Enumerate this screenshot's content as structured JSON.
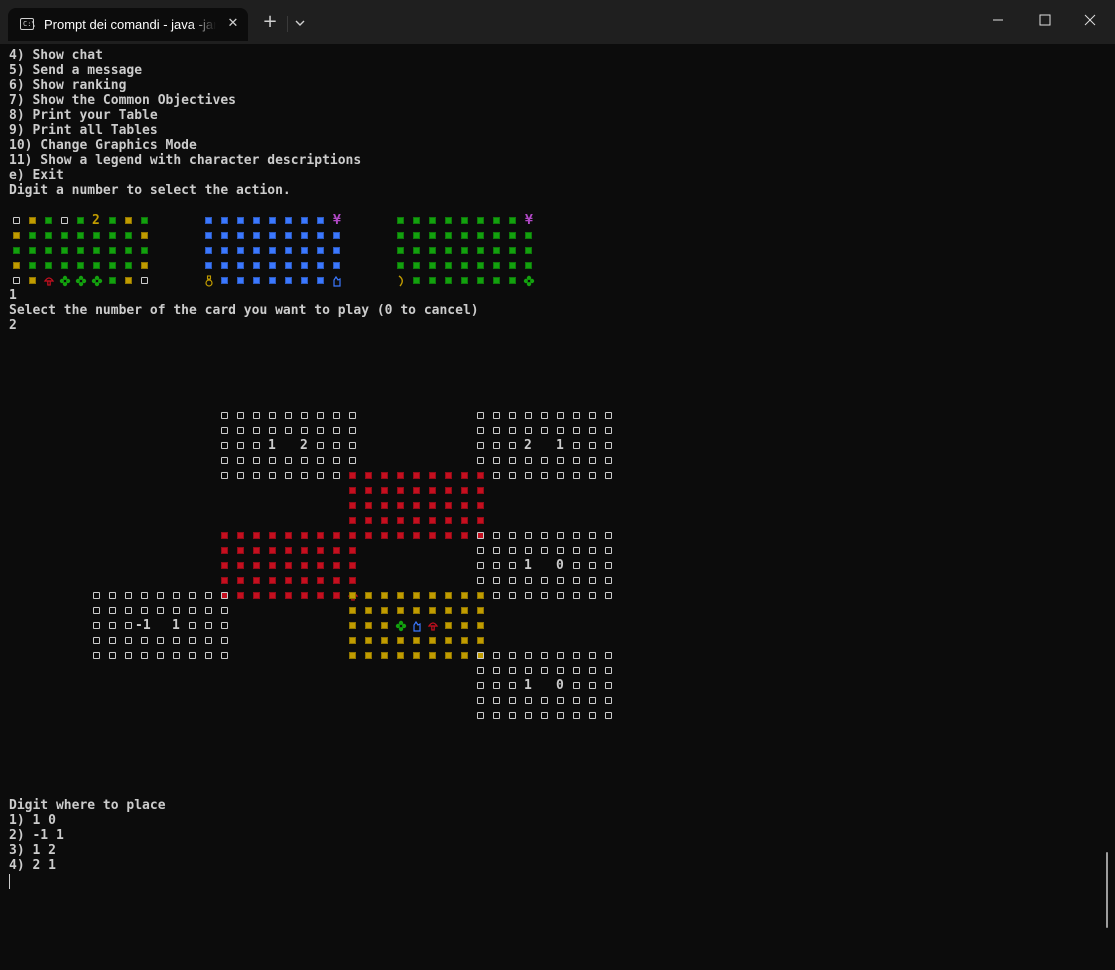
{
  "window": {
    "tab_title": "Prompt dei comandi - java  -jar",
    "new_tab_label": "+",
    "dropdown_label": "⌄",
    "close_tab_label": "✕",
    "minimize_label": "—",
    "maximize_label": "☐",
    "close_label": "✕"
  },
  "terminal": {
    "menu_lines": [
      "4) Show chat",
      "5) Send a message",
      "6) Show ranking",
      "7) Show the Common Objectives",
      "8) Print your Table",
      "9) Print all Tables",
      "10) Change Graphics Mode",
      "11) Show a legend with character descriptions",
      "e) Exit",
      "Digit a number to select the action."
    ],
    "input_1": "1",
    "card_prompt": "Select the number of the card you want to play (0 to cancel)",
    "input_2": "2",
    "place_prompt": "Digit where to place",
    "place_options": [
      "1) 1 0",
      "2) -1 1",
      "3) 1 2",
      "4) 2 1"
    ]
  },
  "hand": {
    "cards": [
      {
        "rows": [
          [
            "o",
            "y",
            "g",
            "o",
            "g",
            "2",
            "g",
            "y",
            "g"
          ],
          [
            "y",
            "g",
            "g",
            "g",
            "g",
            "g",
            "g",
            "g",
            "y"
          ],
          [
            "g",
            "g",
            "g",
            "g",
            "g",
            "g",
            "g",
            "g",
            "g"
          ],
          [
            "y",
            "g",
            "g",
            "g",
            "g",
            "g",
            "g",
            "g",
            "y"
          ],
          [
            "o",
            "y",
            "mushroom",
            "leaf",
            "leaf",
            "leaf",
            "g",
            "y",
            "o"
          ]
        ]
      },
      {
        "rows": [
          [
            "b",
            "b",
            "b",
            "b",
            "b",
            "b",
            "b",
            "b",
            "yen"
          ],
          [
            "b",
            "b",
            "b",
            "b",
            "b",
            "b",
            "b",
            "b",
            "b"
          ],
          [
            "b",
            "b",
            "b",
            "b",
            "b",
            "b",
            "b",
            "b",
            "b"
          ],
          [
            "b",
            "b",
            "b",
            "b",
            "b",
            "b",
            "b",
            "b",
            "b"
          ],
          [
            "potion",
            "b",
            "b",
            "b",
            "b",
            "b",
            "b",
            "b",
            "wolf"
          ]
        ]
      },
      {
        "rows": [
          [
            "g",
            "g",
            "g",
            "g",
            "g",
            "g",
            "g",
            "g",
            "yen"
          ],
          [
            "g",
            "g",
            "g",
            "g",
            "g",
            "g",
            "g",
            "g",
            "g"
          ],
          [
            "g",
            "g",
            "g",
            "g",
            "g",
            "g",
            "g",
            "g",
            "g"
          ],
          [
            "g",
            "g",
            "g",
            "g",
            "g",
            "g",
            "g",
            "g",
            "g"
          ],
          [
            "feather",
            "g",
            "g",
            "g",
            "g",
            "g",
            "g",
            "g",
            "leaf"
          ]
        ]
      }
    ]
  },
  "board": {
    "cells": [
      {
        "type": "outline",
        "coord": "1 2",
        "numbers": [
          "1",
          "",
          "2"
        ]
      },
      {
        "type": "outline",
        "coord": "2 1",
        "numbers": [
          "2",
          "",
          "1"
        ]
      },
      {
        "type": "red",
        "coord": "1 1"
      },
      {
        "type": "red",
        "coord": "0 1"
      },
      {
        "type": "outline",
        "coord": "1 0",
        "numbers": [
          "1",
          "",
          "0"
        ]
      },
      {
        "type": "outline",
        "coord": "-1 1",
        "numbers": [
          "-1",
          "",
          "1"
        ]
      },
      {
        "type": "yellow",
        "coord": "0 0",
        "center": [
          "leaf",
          "wolf",
          "mushroom"
        ]
      },
      {
        "type": "outline",
        "coord": "1 -1",
        "numbers": [
          "1",
          "",
          "0"
        ]
      }
    ]
  },
  "colors": {
    "background": "#0c0c0c",
    "text": "#cccccc",
    "yellow": "#c19c00",
    "green": "#13a10e",
    "blue": "#3b78ff",
    "red": "#c50f1f",
    "magenta": "#b148c6"
  },
  "icons": {
    "square": "▫",
    "yen": "¥",
    "mushroom": "mushroom-icon",
    "leaf": "leaf-icon",
    "potion": "potion-icon",
    "wolf": "wolf-icon",
    "feather": "feather-icon"
  }
}
